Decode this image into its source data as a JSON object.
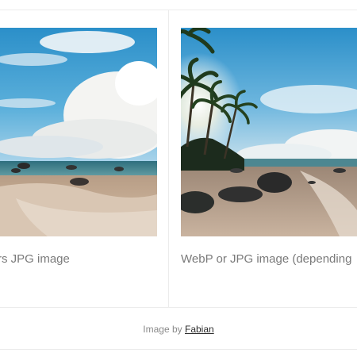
{
  "cards": [
    {
      "image_alt": "tropical beach with clouds",
      "caption": "rs JPG image"
    },
    {
      "image_alt": "beach with palm trees",
      "caption": "WebP or JPG image (depending"
    }
  ],
  "credit": {
    "prefix": "Image by",
    "author": "Fabian"
  }
}
